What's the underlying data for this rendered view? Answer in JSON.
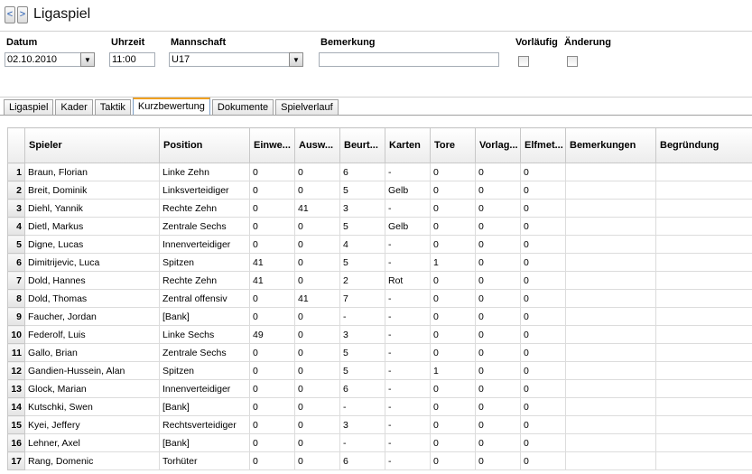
{
  "header": {
    "back_label": "<",
    "forward_label": ">",
    "title": "Ligaspiel"
  },
  "form": {
    "datum_label": "Datum",
    "datum_value": "02.10.2010",
    "uhrzeit_label": "Uhrzeit",
    "uhrzeit_value": "11:00",
    "mannschaft_label": "Mannschaft",
    "mannschaft_value": "U17",
    "bemerkung_label": "Bemerkung",
    "bemerkung_value": "",
    "vorlaeufig_label": "Vorläufig",
    "aenderung_label": "Änderung",
    "dropdown_glyph": "▼"
  },
  "tabs": [
    "Ligaspiel",
    "Kader",
    "Taktik",
    "Kurzbewertung",
    "Dokumente",
    "Spielverlauf"
  ],
  "active_tab": "Kurzbewertung",
  "table": {
    "columns": [
      "",
      "Spieler",
      "Position",
      "Einwe...",
      "Ausw...",
      "Beurt...",
      "Karten",
      "Tore",
      "Vorlag...",
      "Elfmet...",
      "Bemerkungen",
      "Begründung"
    ],
    "rows": [
      [
        "1",
        "Braun, Florian",
        "Linke Zehn",
        "0",
        "0",
        "6",
        "-",
        "0",
        "0",
        "0",
        "",
        ""
      ],
      [
        "2",
        "Breit, Dominik",
        "Linksverteidiger",
        "0",
        "0",
        "5",
        "Gelb",
        "0",
        "0",
        "0",
        "",
        ""
      ],
      [
        "3",
        "Diehl, Yannik",
        "Rechte Zehn",
        "0",
        "41",
        "3",
        "-",
        "0",
        "0",
        "0",
        "",
        ""
      ],
      [
        "4",
        "Dietl, Markus",
        "Zentrale Sechs",
        "0",
        "0",
        "5",
        "Gelb",
        "0",
        "0",
        "0",
        "",
        ""
      ],
      [
        "5",
        "Digne, Lucas",
        "Innenverteidiger",
        "0",
        "0",
        "4",
        "-",
        "0",
        "0",
        "0",
        "",
        ""
      ],
      [
        "6",
        "Dimitrijevic, Luca",
        "Spitzen",
        "41",
        "0",
        "5",
        "-",
        "1",
        "0",
        "0",
        "",
        ""
      ],
      [
        "7",
        "Dold, Hannes",
        "Rechte Zehn",
        "41",
        "0",
        "2",
        "Rot",
        "0",
        "0",
        "0",
        "",
        ""
      ],
      [
        "8",
        "Dold, Thomas",
        "Zentral offensiv",
        "0",
        "41",
        "7",
        "-",
        "0",
        "0",
        "0",
        "",
        ""
      ],
      [
        "9",
        "Faucher, Jordan",
        "[Bank]",
        "0",
        "0",
        "-",
        "-",
        "0",
        "0",
        "0",
        "",
        ""
      ],
      [
        "10",
        "Federolf, Luis",
        "Linke Sechs",
        "49",
        "0",
        "3",
        "-",
        "0",
        "0",
        "0",
        "",
        ""
      ],
      [
        "11",
        "Gallo, Brian",
        "Zentrale Sechs",
        "0",
        "0",
        "5",
        "-",
        "0",
        "0",
        "0",
        "",
        ""
      ],
      [
        "12",
        "Gandien-Hussein, Alan",
        "Spitzen",
        "0",
        "0",
        "5",
        "-",
        "1",
        "0",
        "0",
        "",
        ""
      ],
      [
        "13",
        "Glock, Marian",
        "Innenverteidiger",
        "0",
        "0",
        "6",
        "-",
        "0",
        "0",
        "0",
        "",
        ""
      ],
      [
        "14",
        "Kutschki, Swen",
        "[Bank]",
        "0",
        "0",
        "-",
        "-",
        "0",
        "0",
        "0",
        "",
        ""
      ],
      [
        "15",
        "Kyei, Jeffery",
        "Rechtsverteidiger",
        "0",
        "0",
        "3",
        "-",
        "0",
        "0",
        "0",
        "",
        ""
      ],
      [
        "16",
        "Lehner, Axel",
        "[Bank]",
        "0",
        "0",
        "-",
        "-",
        "0",
        "0",
        "0",
        "",
        ""
      ],
      [
        "17",
        "Rang, Domenic",
        "Torhüter",
        "0",
        "0",
        "6",
        "-",
        "0",
        "0",
        "0",
        "",
        ""
      ]
    ]
  }
}
